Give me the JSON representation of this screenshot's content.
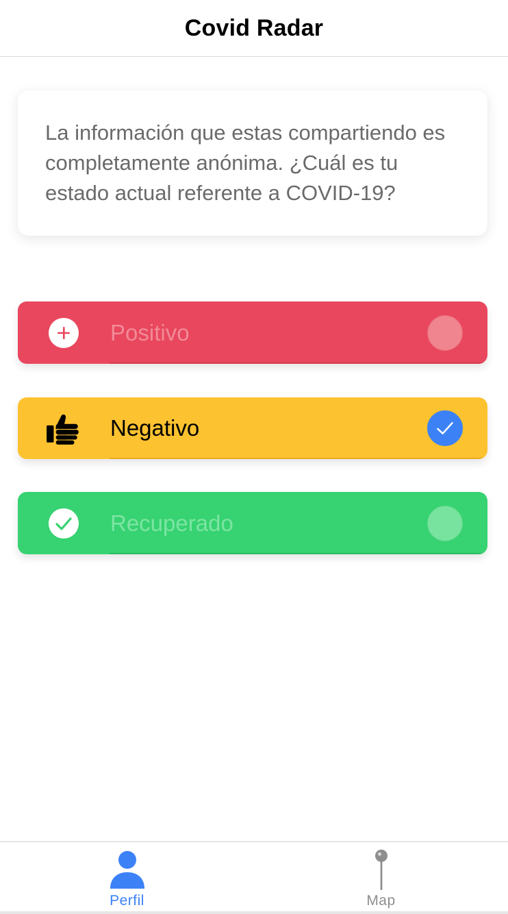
{
  "navbar": {
    "title": "Covid Radar"
  },
  "info_card": {
    "text": "La información que estas compartiendo es completamente anónima. ¿Cuál es tu estado actual referente a COVID-19?"
  },
  "options": [
    {
      "label": "Positivo",
      "icon": "plus-circle-icon",
      "color": "#e8475e",
      "selected": false
    },
    {
      "label": "Negativo",
      "icon": "thumbs-up-icon",
      "color": "#fdc230",
      "selected": true
    },
    {
      "label": "Recuperado",
      "icon": "checkmark-circle-icon",
      "color": "#37d271",
      "selected": false
    }
  ],
  "tabbar": {
    "tabs": [
      {
        "label": "Perfil",
        "icon": "person-icon",
        "active": true
      },
      {
        "label": "Map",
        "icon": "map-pin-icon",
        "active": false
      }
    ]
  },
  "colors": {
    "accent": "#3c82f6",
    "inactive": "#8e8e8e"
  }
}
